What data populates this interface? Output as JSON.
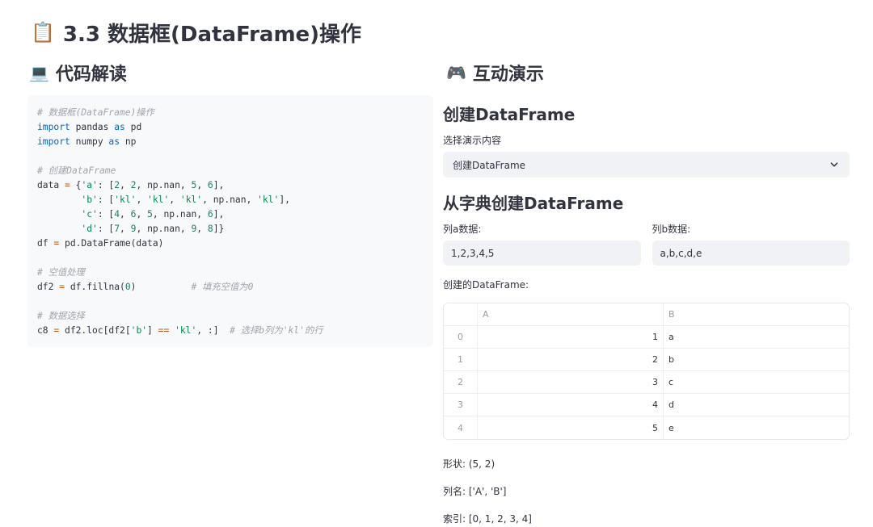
{
  "page": {
    "icon": "clipboard-icon",
    "icon_glyph": "📋",
    "title": "3.3 数据框(DataFrame)操作"
  },
  "code_section": {
    "icon": "laptop-icon",
    "icon_glyph": "💻",
    "title": "代码解读",
    "code": [
      [
        {
          "t": "# 数据框(DataFrame)操作",
          "c": "cm"
        }
      ],
      [
        {
          "t": "import",
          "c": "kw"
        },
        {
          "t": " pandas "
        },
        {
          "t": "as",
          "c": "kw"
        },
        {
          "t": " pd"
        }
      ],
      [
        {
          "t": "import",
          "c": "kw"
        },
        {
          "t": " numpy "
        },
        {
          "t": "as",
          "c": "kw"
        },
        {
          "t": " np"
        }
      ],
      [],
      [
        {
          "t": "# 创建DataFrame",
          "c": "cm"
        }
      ],
      [
        {
          "t": "data "
        },
        {
          "t": "=",
          "c": "op"
        },
        {
          "t": " {"
        },
        {
          "t": "'a'",
          "c": "str"
        },
        {
          "t": ": ["
        },
        {
          "t": "2",
          "c": "num"
        },
        {
          "t": ", "
        },
        {
          "t": "2",
          "c": "num"
        },
        {
          "t": ", np.nan, "
        },
        {
          "t": "5",
          "c": "num"
        },
        {
          "t": ", "
        },
        {
          "t": "6",
          "c": "num"
        },
        {
          "t": "],"
        }
      ],
      [
        {
          "t": "        "
        },
        {
          "t": "'b'",
          "c": "str"
        },
        {
          "t": ": ["
        },
        {
          "t": "'kl'",
          "c": "str"
        },
        {
          "t": ", "
        },
        {
          "t": "'kl'",
          "c": "str"
        },
        {
          "t": ", "
        },
        {
          "t": "'kl'",
          "c": "str"
        },
        {
          "t": ", np.nan, "
        },
        {
          "t": "'kl'",
          "c": "str"
        },
        {
          "t": "],"
        }
      ],
      [
        {
          "t": "        "
        },
        {
          "t": "'c'",
          "c": "str"
        },
        {
          "t": ": ["
        },
        {
          "t": "4",
          "c": "num"
        },
        {
          "t": ", "
        },
        {
          "t": "6",
          "c": "num"
        },
        {
          "t": ", "
        },
        {
          "t": "5",
          "c": "num"
        },
        {
          "t": ", np.nan, "
        },
        {
          "t": "6",
          "c": "num"
        },
        {
          "t": "],"
        }
      ],
      [
        {
          "t": "        "
        },
        {
          "t": "'d'",
          "c": "str"
        },
        {
          "t": ": ["
        },
        {
          "t": "7",
          "c": "num"
        },
        {
          "t": ", "
        },
        {
          "t": "9",
          "c": "num"
        },
        {
          "t": ", np.nan, "
        },
        {
          "t": "9",
          "c": "num"
        },
        {
          "t": ", "
        },
        {
          "t": "8",
          "c": "num"
        },
        {
          "t": "]}"
        }
      ],
      [
        {
          "t": "df "
        },
        {
          "t": "=",
          "c": "op"
        },
        {
          "t": " pd.DataFrame(data)"
        }
      ],
      [],
      [
        {
          "t": "# 空值处理",
          "c": "cm"
        }
      ],
      [
        {
          "t": "df2 "
        },
        {
          "t": "=",
          "c": "op"
        },
        {
          "t": " df.fillna("
        },
        {
          "t": "0",
          "c": "num"
        },
        {
          "t": ")          "
        },
        {
          "t": "# 填充空值为0",
          "c": "cm"
        }
      ],
      [],
      [
        {
          "t": "# 数据选择",
          "c": "cm"
        }
      ],
      [
        {
          "t": "c8 "
        },
        {
          "t": "=",
          "c": "op"
        },
        {
          "t": " df2.loc[df2["
        },
        {
          "t": "'b'",
          "c": "str"
        },
        {
          "t": "] "
        },
        {
          "t": "==",
          "c": "op"
        },
        {
          "t": " "
        },
        {
          "t": "'kl'",
          "c": "str"
        },
        {
          "t": ", :]  "
        },
        {
          "t": "# 选择b列为'kl'的行",
          "c": "cm"
        }
      ]
    ]
  },
  "demo_section": {
    "icon": "game-controller-icon",
    "icon_glyph": "🎮",
    "title": "互动演示",
    "subheader": "创建DataFrame",
    "select": {
      "label": "选择演示内容",
      "value": "创建DataFrame",
      "icon": "chevron-down-icon"
    },
    "dict_subheader": "从字典创建DataFrame",
    "input_a": {
      "label": "列a数据:",
      "value": "1,2,3,4,5"
    },
    "input_b": {
      "label": "列b数据:",
      "value": "a,b,c,d,e"
    },
    "df_label": "创建的DataFrame:",
    "dataframe": {
      "columns": [
        "",
        "A",
        "B"
      ],
      "rows": [
        [
          "0",
          "1",
          "a"
        ],
        [
          "1",
          "2",
          "b"
        ],
        [
          "2",
          "3",
          "c"
        ],
        [
          "3",
          "4",
          "d"
        ],
        [
          "4",
          "5",
          "e"
        ]
      ]
    },
    "shape_text": "形状: (5, 2)",
    "columns_text": "列名: ['A', 'B']",
    "index_text": "索引: [0, 1, 2, 3, 4]"
  }
}
